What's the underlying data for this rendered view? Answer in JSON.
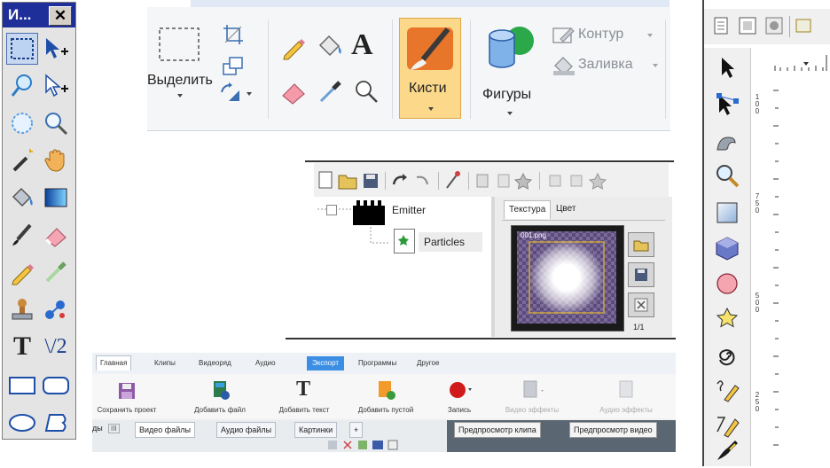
{
  "toolbox": {
    "title": "И...",
    "close": "✕",
    "text_tool": "T",
    "line_tool": "\\/2"
  },
  "paint_ribbon": {
    "select_label": "Выделить",
    "brushes_label": "Кисти",
    "shapes_label": "Фигуры",
    "outline_label": "Контур",
    "fill_label": "Заливка",
    "text_icon": "A"
  },
  "particle_editor": {
    "tree": {
      "root": "Emitter",
      "child": "Particles"
    },
    "tabs": [
      "Текстура",
      "Цвет"
    ],
    "preview_file": "001.png",
    "page_counter": "1/1"
  },
  "video_editor": {
    "tabs": [
      "Главная",
      "Клипы",
      "Видеоряд",
      "Аудио",
      "Экспорт",
      "Программы",
      "Другое"
    ],
    "active_tab": "Экспорт",
    "buttons": {
      "save": "Сохранить проект",
      "add_file": "Добавить файл",
      "add_text": "Добавить текст",
      "add_empty": "Добавить пустой",
      "record": "Запись",
      "video_effects": "Видео эффекты",
      "audio_effects": "Аудио эффекты"
    },
    "file_tabs": {
      "partial": "ды",
      "partial_badge": "ІІІ",
      "video": "Видео файлы",
      "audio": "Аудио файлы",
      "pictures": "Картинки",
      "add": "+"
    },
    "preview_tabs": {
      "clip": "Предпросмотр клипа",
      "video": "Предпросмотр видео"
    }
  },
  "vector_editor": {
    "ruler_labels": [
      "1\n0\n0",
      "7\n5\n0",
      "5\n0\n0",
      "2\n5\n0"
    ]
  },
  "colors": {
    "toolbox_title_bg": "#1e2f9a",
    "ribbon_selected": "#fbd88a",
    "video_export_tab": "#3b8ee4",
    "record_red": "#d11a1a"
  }
}
